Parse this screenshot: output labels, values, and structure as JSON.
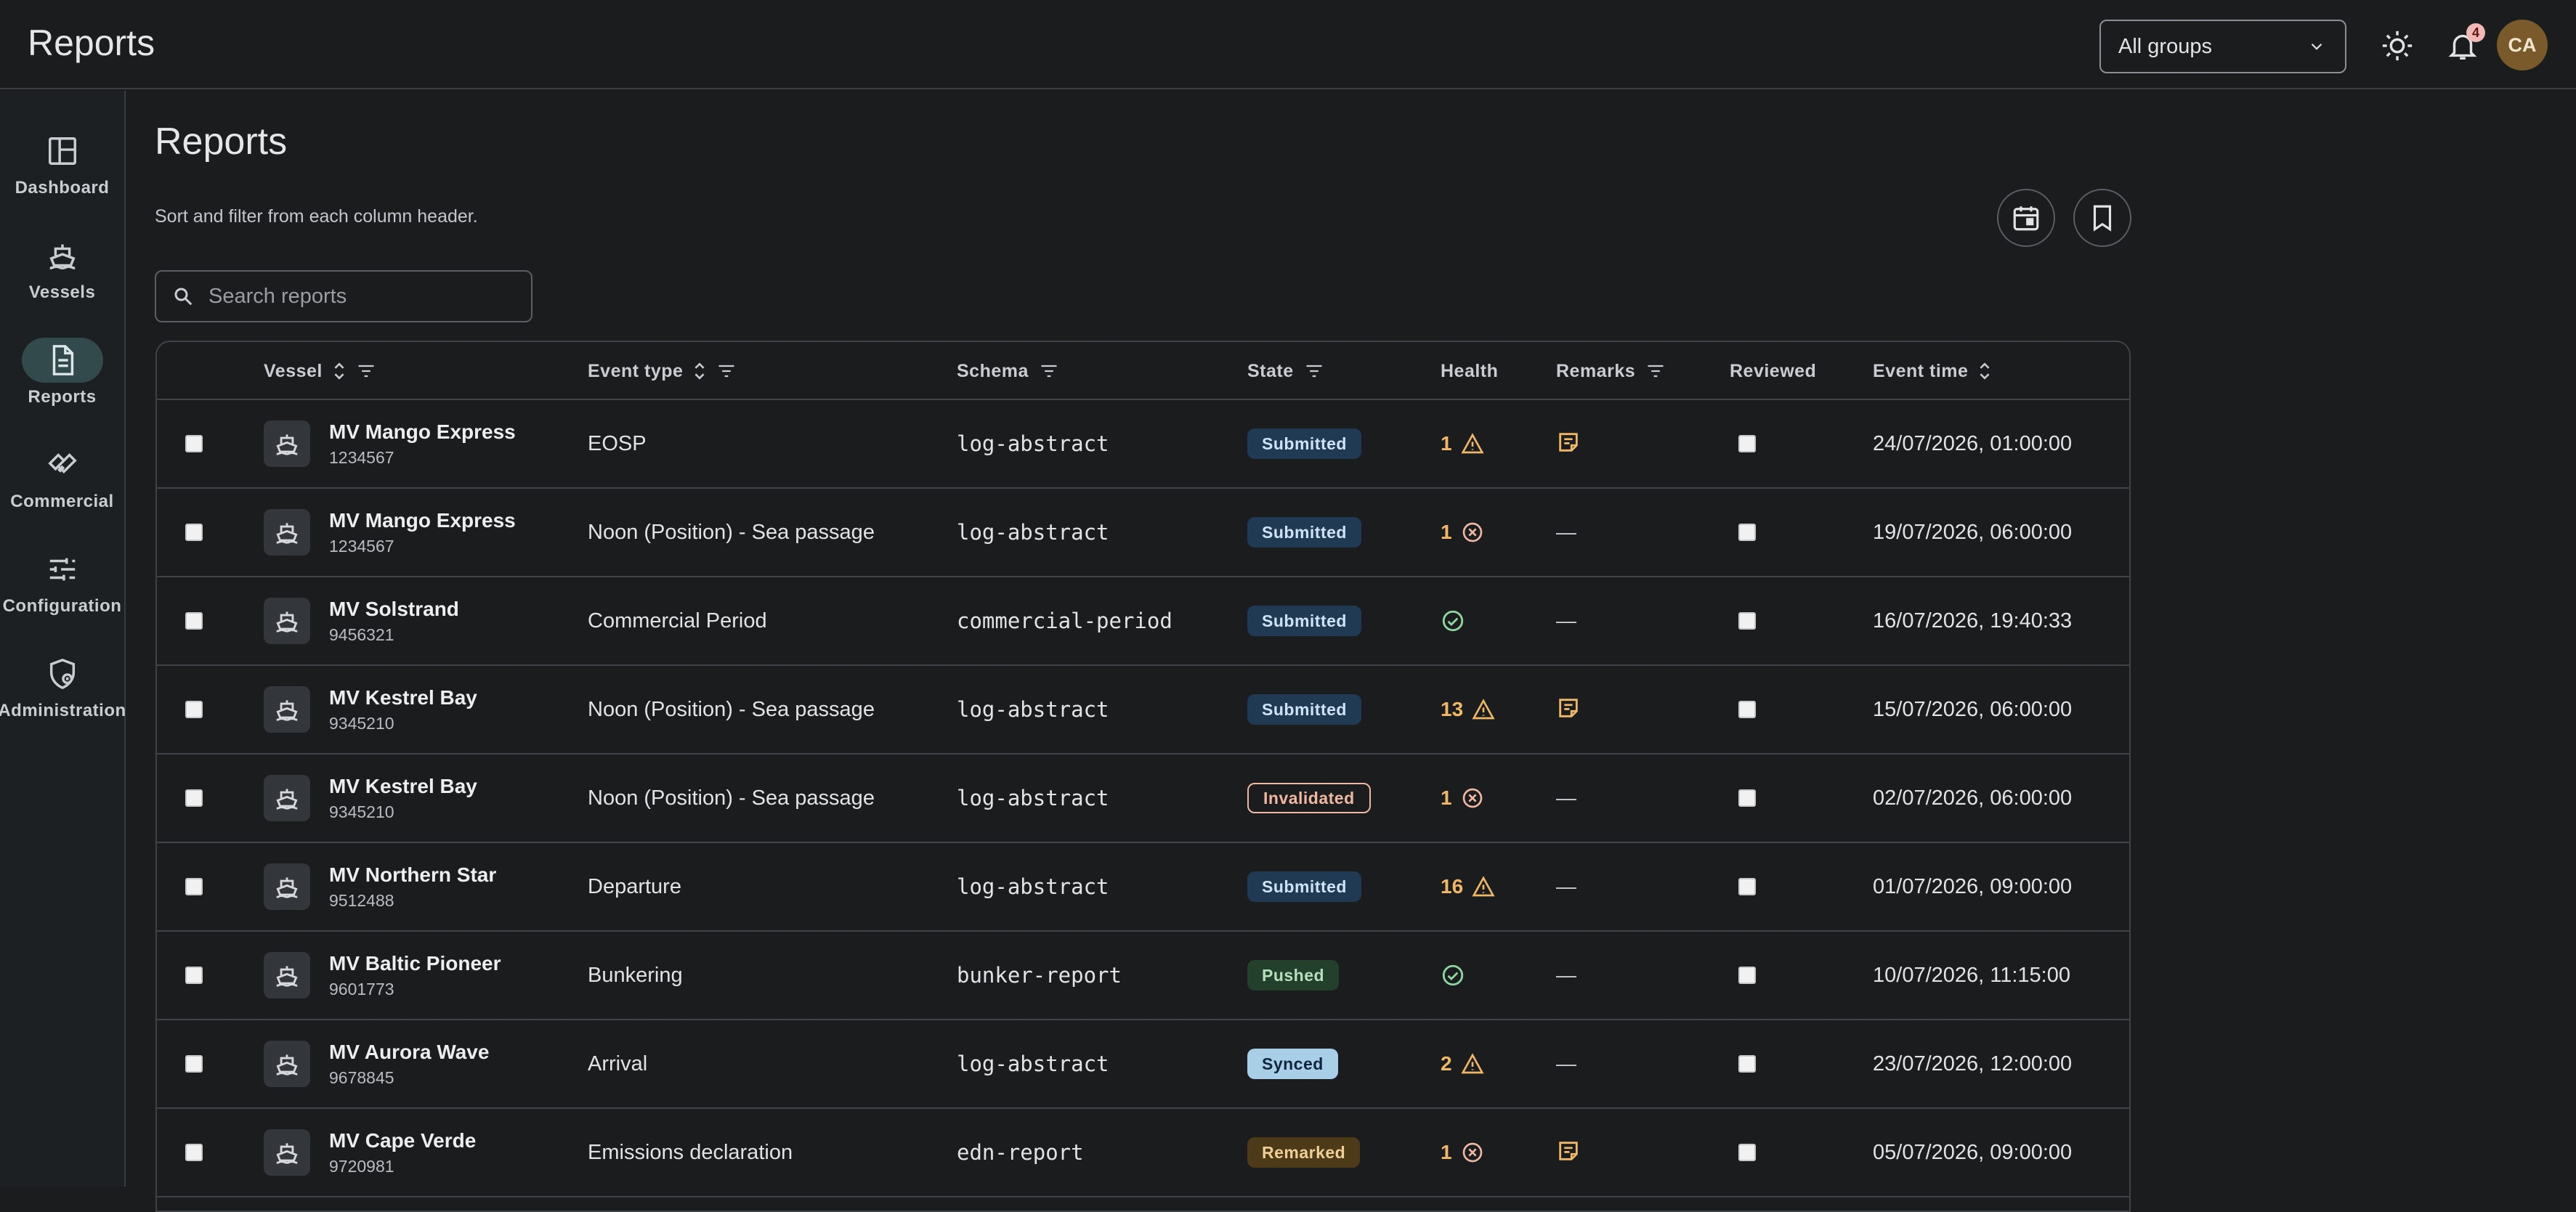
{
  "header": {
    "title": "Reports",
    "group_select": "All groups",
    "notification_count": "4",
    "avatar_initials": "CA"
  },
  "sidebar": {
    "items": [
      {
        "label": "Dashboard",
        "icon": "dashboard-icon",
        "active": false
      },
      {
        "label": "Vessels",
        "icon": "ship-icon",
        "active": false
      },
      {
        "label": "Reports",
        "icon": "document-icon",
        "active": true
      },
      {
        "label": "Commercial",
        "icon": "handshake-icon",
        "active": false
      },
      {
        "label": "Configuration",
        "icon": "sliders-icon",
        "active": false
      },
      {
        "label": "Administration",
        "icon": "shield-icon",
        "active": false
      }
    ]
  },
  "main": {
    "title": "Reports",
    "subtitle": "Sort and filter from each column header.",
    "search_placeholder": "Search reports"
  },
  "table": {
    "columns": [
      "Vessel",
      "Event type",
      "Schema",
      "State",
      "Health",
      "Remarks",
      "Reviewed",
      "Event time"
    ],
    "rows": [
      {
        "vessel": "MV Mango Express",
        "imo": "1234567",
        "event_type": "EOSP",
        "schema": "log-abstract",
        "state": "Submitted",
        "health_count": "1",
        "health_icon": "warning",
        "remarks": "note",
        "event_time": "24/07/2026, 01:00:00"
      },
      {
        "vessel": "MV Mango Express",
        "imo": "1234567",
        "event_type": "Noon (Position) - Sea passage",
        "schema": "log-abstract",
        "state": "Submitted",
        "health_count": "1",
        "health_icon": "error",
        "remarks": "—",
        "event_time": "19/07/2026, 06:00:00"
      },
      {
        "vessel": "MV Solstrand",
        "imo": "9456321",
        "event_type": "Commercial Period",
        "schema": "commercial-period",
        "state": "Submitted",
        "health_count": "",
        "health_icon": "ok",
        "remarks": "—",
        "event_time": "16/07/2026, 19:40:33"
      },
      {
        "vessel": "MV Kestrel Bay",
        "imo": "9345210",
        "event_type": "Noon (Position) - Sea passage",
        "schema": "log-abstract",
        "state": "Submitted",
        "health_count": "13",
        "health_icon": "warning",
        "remarks": "note",
        "event_time": "15/07/2026, 06:00:00"
      },
      {
        "vessel": "MV Kestrel Bay",
        "imo": "9345210",
        "event_type": "Noon (Position) - Sea passage",
        "schema": "log-abstract",
        "state": "Invalidated",
        "health_count": "1",
        "health_icon": "error",
        "remarks": "—",
        "event_time": "02/07/2026, 06:00:00"
      },
      {
        "vessel": "MV Northern Star",
        "imo": "9512488",
        "event_type": "Departure",
        "schema": "log-abstract",
        "state": "Submitted",
        "health_count": "16",
        "health_icon": "warning",
        "remarks": "—",
        "event_time": "01/07/2026, 09:00:00"
      },
      {
        "vessel": "MV Baltic Pioneer",
        "imo": "9601773",
        "event_type": "Bunkering",
        "schema": "bunker-report",
        "state": "Pushed",
        "health_count": "",
        "health_icon": "ok",
        "remarks": "—",
        "event_time": "10/07/2026, 11:15:00"
      },
      {
        "vessel": "MV Aurora Wave",
        "imo": "9678845",
        "event_type": "Arrival",
        "schema": "log-abstract",
        "state": "Synced",
        "health_count": "2",
        "health_icon": "warning",
        "remarks": "—",
        "event_time": "23/07/2026, 12:00:00"
      },
      {
        "vessel": "MV Cape Verde",
        "imo": "9720981",
        "event_type": "Emissions declaration",
        "schema": "edn-report",
        "state": "Remarked",
        "health_count": "1",
        "health_icon": "error",
        "remarks": "note",
        "event_time": "05/07/2026, 09:00:00"
      }
    ]
  },
  "state_colors": {
    "Submitted": {
      "bg": "#1f3a52",
      "fg": "#cfe3f7",
      "border": "none"
    },
    "Invalidated": {
      "bg": "transparent",
      "fg": "#f0b8a0",
      "border": "#f0b8a0"
    },
    "Pushed": {
      "bg": "#22402b",
      "fg": "#b5dfbd",
      "border": "none"
    },
    "Synced": {
      "bg": "#a9cfe8",
      "fg": "#10263a",
      "border": "none"
    },
    "Remarked": {
      "bg": "#4d3a18",
      "fg": "#f0cf96",
      "border": "none"
    }
  },
  "colors": {
    "warning": "#f0b866",
    "error": "#f0b8a0",
    "ok": "#8fd7a0",
    "remark_icon": "#f0b866"
  }
}
